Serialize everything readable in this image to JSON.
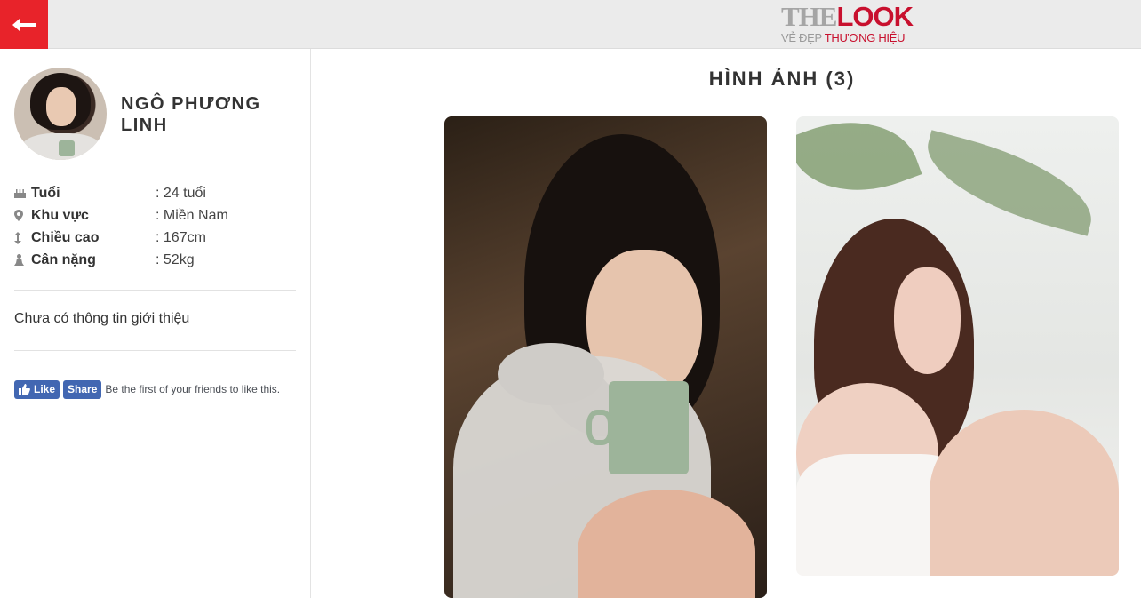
{
  "header": {
    "back_icon": "arrow-left-icon",
    "logo_the": "THE",
    "logo_look": "LOOK",
    "logo_sub_a": "VẺ ĐẸP ",
    "logo_sub_b": "THƯƠNG HIỆU",
    "accent_color": "#e8232a"
  },
  "profile": {
    "name": "NGÔ PHƯƠNG LINH",
    "fields": [
      {
        "icon": "cake-icon",
        "label": "Tuổi",
        "value": ": 24 tuổi"
      },
      {
        "icon": "map-pin-icon",
        "label": "Khu vực",
        "value": ": Miền Nam"
      },
      {
        "icon": "height-icon",
        "label": "Chiều cao",
        "value": ": 167cm"
      },
      {
        "icon": "weight-icon",
        "label": "Cân nặng",
        "value": ": 52kg"
      }
    ],
    "intro": "Chưa có thông tin giới thiệu"
  },
  "facebook": {
    "like_label": "Like",
    "share_label": "Share",
    "social_text": "Be the first of your friends to like this.",
    "color": "#4267b2"
  },
  "gallery": {
    "title": "HÌNH ẢNH (3)"
  }
}
